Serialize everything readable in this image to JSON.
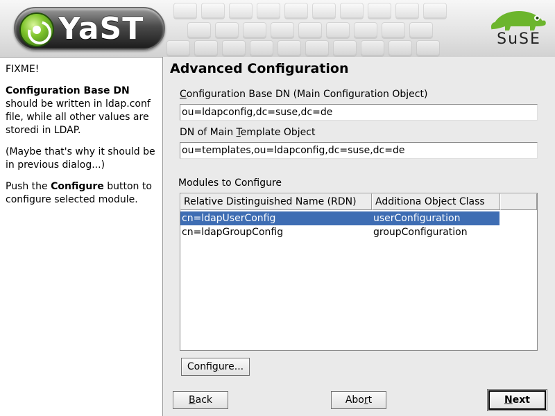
{
  "banner": {
    "app_name": "YaST",
    "vendor": "SuSE"
  },
  "help": {
    "heading": "FIXME!",
    "p1_bold": "Configuration Base DN",
    "p1_rest": " should be written in ldap.conf file, while all other values are storedi in LDAP.",
    "p2": "(Maybe that's why it should be in previous dialog...)",
    "p3_pre": "Push the ",
    "p3_bold": "Configure",
    "p3_post": " button to configure selected module."
  },
  "main": {
    "title": "Advanced Configuration",
    "base_dn": {
      "label_mnemonic": "C",
      "label_rest": "onfiguration Base DN (Main Configuration Object)",
      "value": "ou=ldapconfig,dc=suse,dc=de"
    },
    "template_dn": {
      "label_pre": "DN of Main ",
      "label_mnemonic": "T",
      "label_rest": "emplate Object",
      "value": "ou=templates,ou=ldapconfig,dc=suse,dc=de"
    },
    "modules": {
      "label": "Modules to Configure",
      "columns": [
        "Relative Distinguished Name (RDN)",
        "Additiona Object Class",
        ""
      ],
      "rows": [
        {
          "rdn": "cn=ldapUserConfig",
          "class": "userConfiguration",
          "selected": true
        },
        {
          "rdn": "cn=ldapGroupConfig",
          "class": "groupConfiguration",
          "selected": false
        }
      ]
    },
    "configure_button": {
      "pre": "Confi",
      "mnemonic": "g",
      "post": "ure..."
    }
  },
  "footer": {
    "back": {
      "mnemonic": "B",
      "rest": "ack"
    },
    "abort": {
      "pre": "Abo",
      "mnemonic": "r",
      "post": "t"
    },
    "next": {
      "mnemonic": "N",
      "rest": "ext"
    }
  },
  "colors": {
    "selection": "#3e6db3",
    "suse_green": "#6cb52d"
  }
}
